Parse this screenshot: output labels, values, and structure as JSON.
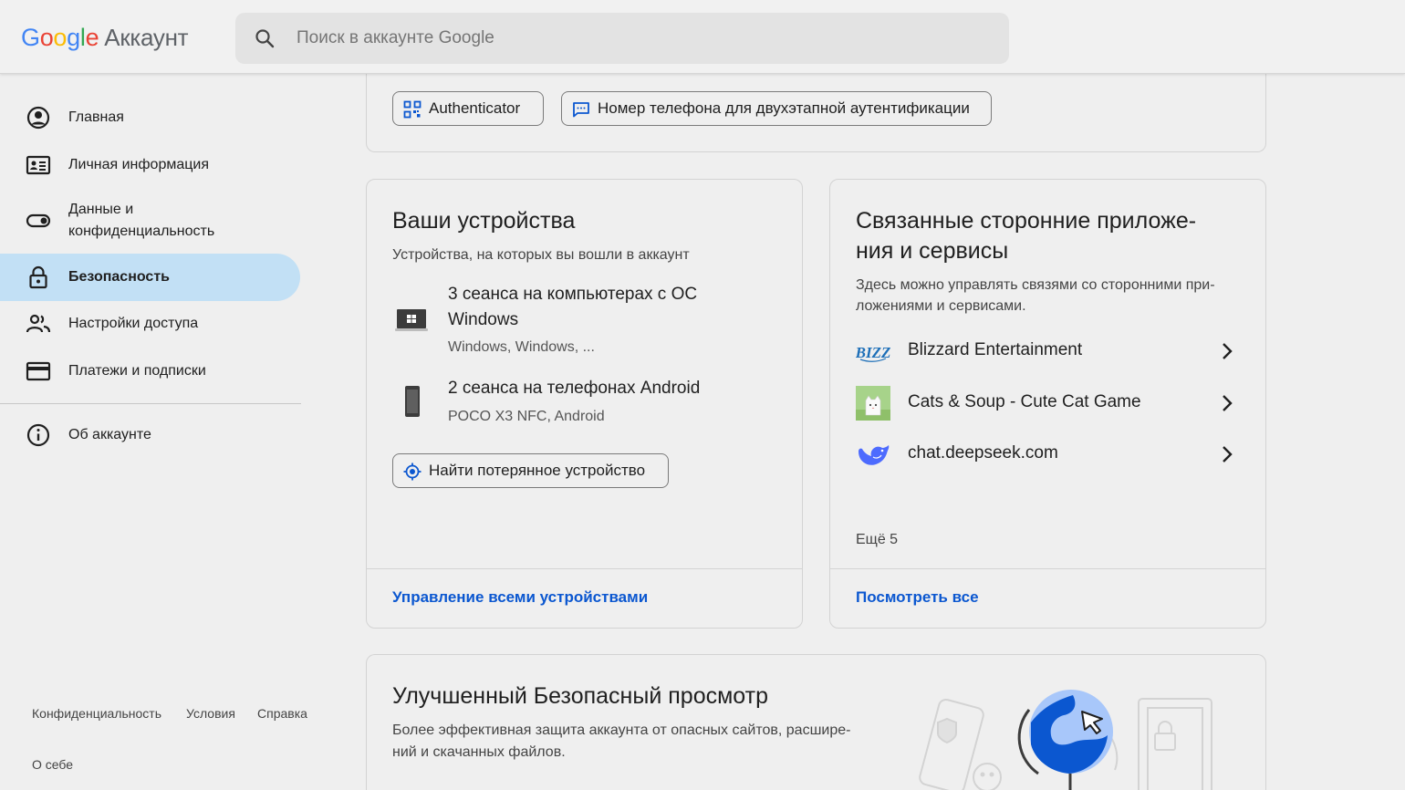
{
  "header": {
    "logo_g1": "G",
    "logo_o1": "o",
    "logo_o2": "o",
    "logo_g2": "g",
    "logo_l": "l",
    "logo_e": "e",
    "product": "Аккаунт",
    "search_placeholder": "Поиск в аккаунте Google"
  },
  "sidebar": {
    "items": [
      {
        "label": "Главная",
        "icon": "account-circle-icon"
      },
      {
        "label": "Личная информация",
        "icon": "id-card-icon"
      },
      {
        "label": "Данные и конфиденциальность",
        "icon": "toggle-icon"
      },
      {
        "label": "Безопасность",
        "icon": "lock-icon",
        "active": true
      },
      {
        "label": "Настройки доступа",
        "icon": "people-icon"
      },
      {
        "label": "Платежи и подписки",
        "icon": "credit-card-icon"
      },
      {
        "label": "Об аккаунте",
        "icon": "info-icon"
      }
    ],
    "footer": {
      "privacy": "Конфиденциальность",
      "terms": "Условия",
      "help": "Справка",
      "about": "О себе"
    }
  },
  "two_step_card": {
    "chip_authenticator": "Authenticator",
    "chip_phone": "Номер телефона для двухэтапной аутентификации"
  },
  "devices_card": {
    "title": "Ваши устройства",
    "subtitle": "Устройства, на которых вы вошли в аккаунт",
    "devices": [
      {
        "name": "3 сеанса на компьютерах с ОС Windows",
        "detail": "Windows, Windows, ...",
        "icon": "laptop-icon"
      },
      {
        "name": "2 сеанса на телефонах Android",
        "detail": "POCO X3 NFC, Android",
        "icon": "phone-icon"
      }
    ],
    "find_button": "Найти потерянное устройство",
    "manage_link": "Управление всеми устройствами"
  },
  "apps_card": {
    "title_line1": "Связанные сторонние приложе-",
    "title_line2": "ния и сервисы",
    "subtitle_line1": "Здесь можно управлять связями со сторонними при-",
    "subtitle_line2": "ложениями и сервисами.",
    "apps": [
      {
        "name": "Blizzard Entertainment",
        "icon": "blizzard-logo-icon"
      },
      {
        "name": "Cats & Soup - Cute Cat Game",
        "icon": "cats-soup-logo-icon"
      },
      {
        "name": "chat.deepseek.com",
        "icon": "deepseek-logo-icon"
      }
    ],
    "more": "Ещё 5",
    "see_all_link": "Посмотреть все"
  },
  "safe_browsing_card": {
    "title": "Улучшенный Безопасный просмотр",
    "desc_line1": "Более эффективная защита аккаунта от опасных сайтов, расшире-",
    "desc_line2": "ний и скачанных файлов."
  },
  "colors": {
    "accent": "#0b57d0",
    "active_nav": "#c2e0f5",
    "background": "#efefef"
  }
}
